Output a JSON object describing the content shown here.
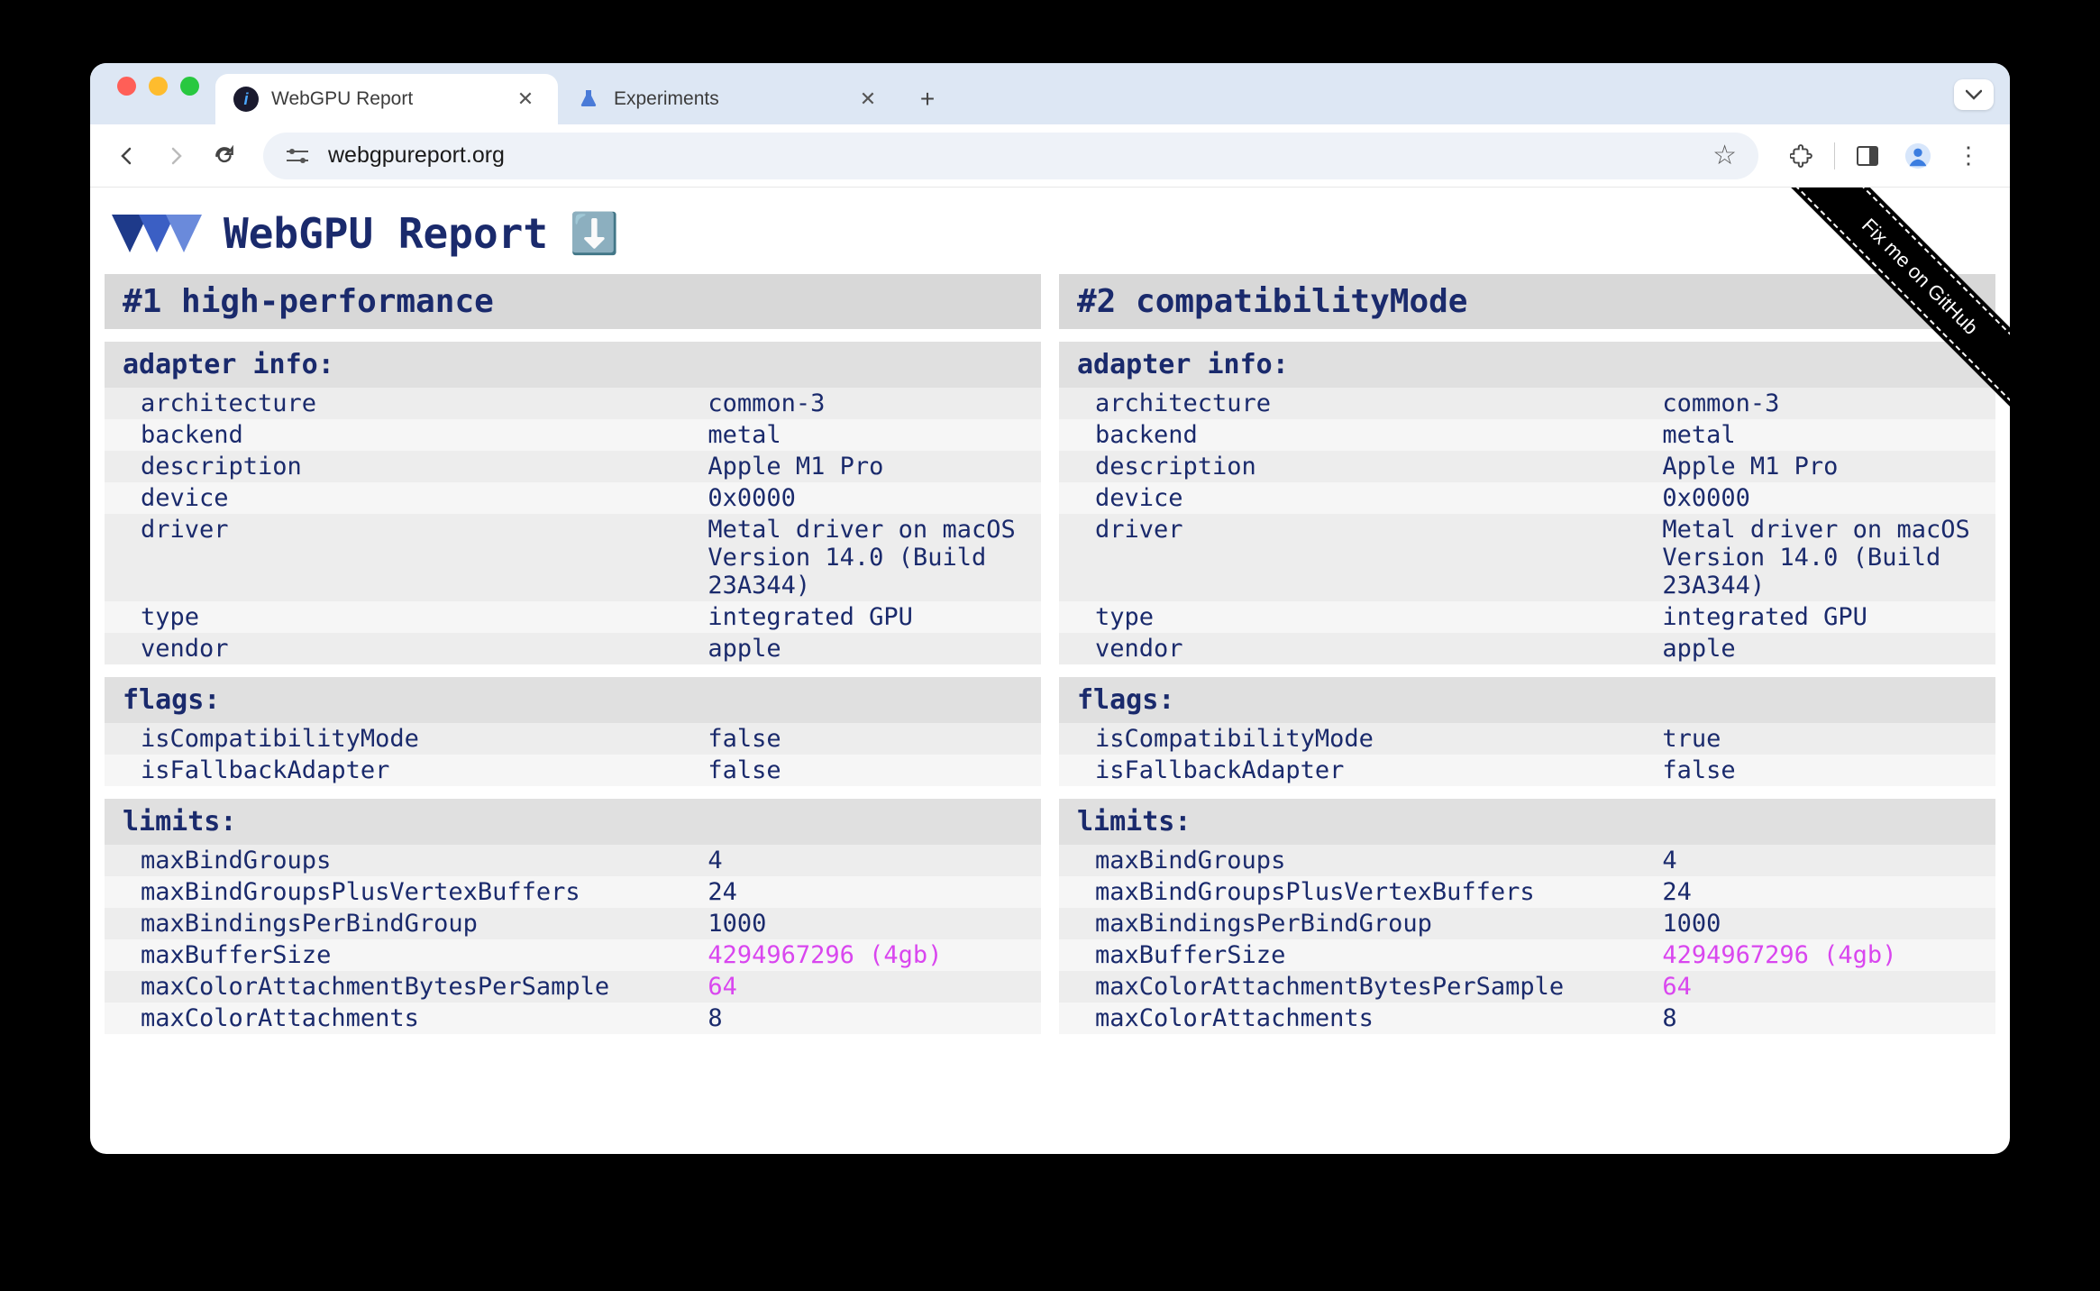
{
  "browser": {
    "tabs": [
      {
        "title": "WebGPU Report",
        "favicon": "webgpu",
        "active": true
      },
      {
        "title": "Experiments",
        "favicon": "experiments",
        "active": false
      }
    ],
    "url": "webgpureport.org"
  },
  "page": {
    "title": "WebGPU Report",
    "github_ribbon": "Fix me on GitHub"
  },
  "adapters": [
    {
      "heading": "#1 high-performance",
      "sections": [
        {
          "label": "adapter info:",
          "rows": [
            {
              "k": "architecture",
              "v": "common-3"
            },
            {
              "k": "backend",
              "v": "metal"
            },
            {
              "k": "description",
              "v": "Apple M1 Pro"
            },
            {
              "k": "device",
              "v": "0x0000"
            },
            {
              "k": "driver",
              "v": "Metal driver on macOS Version 14.0 (Build 23A344)"
            },
            {
              "k": "type",
              "v": "integrated GPU"
            },
            {
              "k": "vendor",
              "v": "apple"
            }
          ]
        },
        {
          "label": "flags:",
          "rows": [
            {
              "k": "isCompatibilityMode",
              "v": "false"
            },
            {
              "k": "isFallbackAdapter",
              "v": "false"
            }
          ]
        },
        {
          "label": "limits:",
          "rows": [
            {
              "k": "maxBindGroups",
              "v": "4"
            },
            {
              "k": "maxBindGroupsPlusVertexBuffers",
              "v": "24"
            },
            {
              "k": "maxBindingsPerBindGroup",
              "v": "1000"
            },
            {
              "k": "maxBufferSize",
              "v": "4294967296 (4gb)",
              "hl": true
            },
            {
              "k": "maxColorAttachmentBytesPerSample",
              "v": "64",
              "hl": true
            },
            {
              "k": "maxColorAttachments",
              "v": "8"
            }
          ]
        }
      ]
    },
    {
      "heading": "#2 compatibilityMode",
      "sections": [
        {
          "label": "adapter info:",
          "rows": [
            {
              "k": "architecture",
              "v": "common-3"
            },
            {
              "k": "backend",
              "v": "metal"
            },
            {
              "k": "description",
              "v": "Apple M1 Pro"
            },
            {
              "k": "device",
              "v": "0x0000"
            },
            {
              "k": "driver",
              "v": "Metal driver on macOS Version 14.0 (Build 23A344)"
            },
            {
              "k": "type",
              "v": "integrated GPU"
            },
            {
              "k": "vendor",
              "v": "apple"
            }
          ]
        },
        {
          "label": "flags:",
          "rows": [
            {
              "k": "isCompatibilityMode",
              "v": "true"
            },
            {
              "k": "isFallbackAdapter",
              "v": "false"
            }
          ]
        },
        {
          "label": "limits:",
          "rows": [
            {
              "k": "maxBindGroups",
              "v": "4"
            },
            {
              "k": "maxBindGroupsPlusVertexBuffers",
              "v": "24"
            },
            {
              "k": "maxBindingsPerBindGroup",
              "v": "1000"
            },
            {
              "k": "maxBufferSize",
              "v": "4294967296 (4gb)",
              "hl": true
            },
            {
              "k": "maxColorAttachmentBytesPerSample",
              "v": "64",
              "hl": true
            },
            {
              "k": "maxColorAttachments",
              "v": "8"
            }
          ]
        }
      ]
    }
  ]
}
